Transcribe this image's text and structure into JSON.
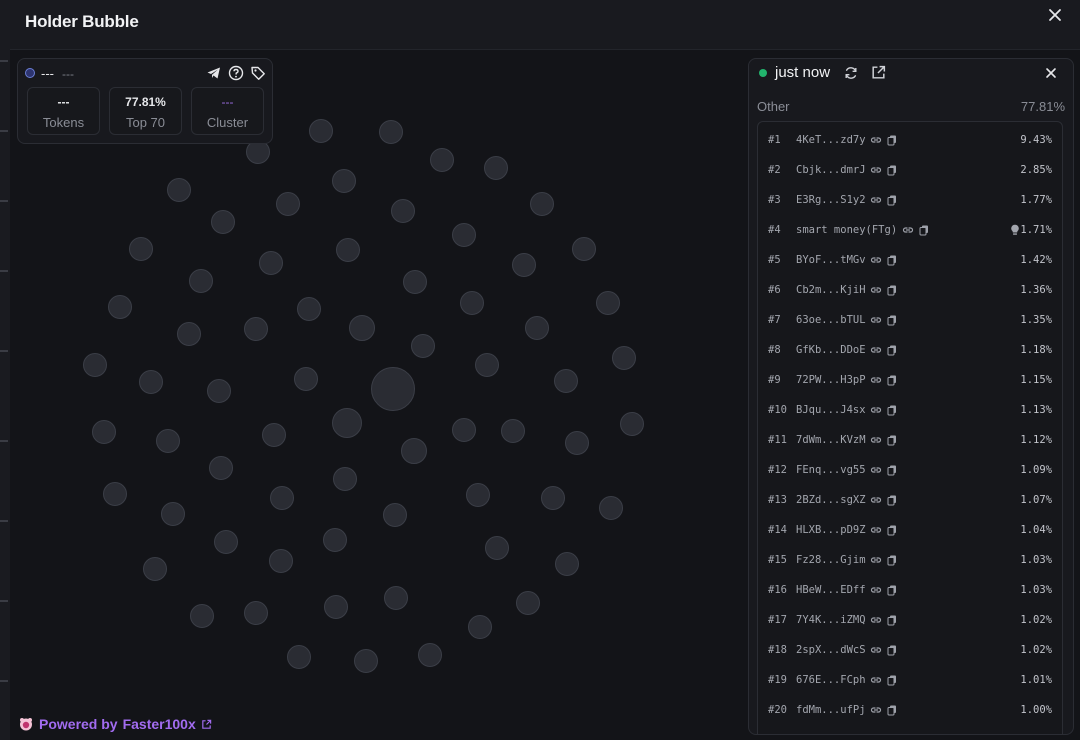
{
  "header": {
    "title": "Holder Bubble"
  },
  "info": {
    "name": "---",
    "sub": "---",
    "stats": [
      {
        "value": "---",
        "label": "Tokens"
      },
      {
        "value": "77.81%",
        "label": "Top 70"
      },
      {
        "value": "---",
        "label": "Cluster"
      }
    ],
    "icons": [
      "telegram-icon",
      "help-icon",
      "tag-icon"
    ]
  },
  "list": {
    "time": "just now",
    "other_label": "Other",
    "other_pct": "77.81%",
    "rows": [
      {
        "rank": "#1",
        "addr": "4KeT...zd7y",
        "pct": "9.43%"
      },
      {
        "rank": "#2",
        "addr": "Cbjk...dmrJ",
        "pct": "2.85%"
      },
      {
        "rank": "#3",
        "addr": "E3Rg...S1y2",
        "pct": "1.77%"
      },
      {
        "rank": "#4",
        "addr": "smart money(FTg)",
        "pct": "1.71%",
        "bulb": true
      },
      {
        "rank": "#5",
        "addr": "BYoF...tMGv",
        "pct": "1.42%"
      },
      {
        "rank": "#6",
        "addr": "Cb2m...KjiH",
        "pct": "1.36%"
      },
      {
        "rank": "#7",
        "addr": "63oe...bTUL",
        "pct": "1.35%"
      },
      {
        "rank": "#8",
        "addr": "GfKb...DDoE",
        "pct": "1.18%"
      },
      {
        "rank": "#9",
        "addr": "72PW...H3pP",
        "pct": "1.15%"
      },
      {
        "rank": "#10",
        "addr": "BJqu...J4sx",
        "pct": "1.13%"
      },
      {
        "rank": "#11",
        "addr": "7dWm...KVzM",
        "pct": "1.12%"
      },
      {
        "rank": "#12",
        "addr": "FEnq...vg55",
        "pct": "1.09%"
      },
      {
        "rank": "#13",
        "addr": "2BZd...sgXZ",
        "pct": "1.07%"
      },
      {
        "rank": "#14",
        "addr": "HLXB...pD9Z",
        "pct": "1.04%"
      },
      {
        "rank": "#15",
        "addr": "Fz28...Gjim",
        "pct": "1.03%"
      },
      {
        "rank": "#16",
        "addr": "HBeW...EDff",
        "pct": "1.03%"
      },
      {
        "rank": "#17",
        "addr": "7Y4K...iZMQ",
        "pct": "1.02%"
      },
      {
        "rank": "#18",
        "addr": "2spX...dWcS",
        "pct": "1.02%"
      },
      {
        "rank": "#19",
        "addr": "676E...FCph",
        "pct": "1.01%"
      },
      {
        "rank": "#20",
        "addr": "fdMm...ufPj",
        "pct": "1.00%"
      }
    ]
  },
  "footer": {
    "prefix": "Powered by",
    "brand": "Faster100x"
  },
  "colors": {
    "accent": "#a26cf0",
    "status_online": "#22b46d",
    "bubble": "#2a2c33"
  }
}
